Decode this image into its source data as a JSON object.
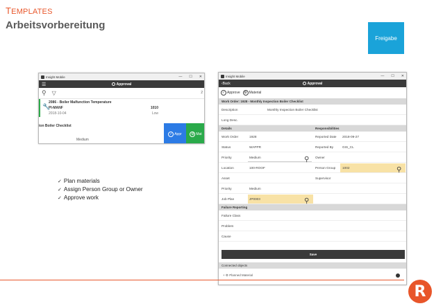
{
  "slide": {
    "kicker_initial": "T",
    "kicker_rest": "EMPLATES",
    "title": "Arbeitsvorbereitung",
    "freigabe_button": "Freigabe",
    "checklist": [
      "Plan materials",
      "Assign Person Group or Owner",
      "Approve work"
    ]
  },
  "win1": {
    "app_name": "Insight Mobile",
    "controls": [
      "—",
      "☐",
      "✕"
    ],
    "appbar_title": "Approval",
    "tools_number": "2",
    "item": {
      "title": "2086 - Boiler Malfunction Temperature",
      "location": "PI-MANF",
      "code": "1010",
      "date": "2018-10-04",
      "priority": "Low"
    },
    "checklist_text": "ion Boiler Checklist",
    "priority_text": "Medium",
    "approve_btn": "Appr",
    "material_btn": "Mat"
  },
  "win2": {
    "app_name": "Insight Mobile",
    "controls": [
      "—",
      "☐",
      "✕"
    ],
    "back_label": "Back",
    "appbar_title": "Approval",
    "approve_label": "Approve",
    "material_label": "Material",
    "work_order_header": "Work Order: 1928 - Monthly Inspection Boiler Checklist",
    "description_label": "Description",
    "description_value": "Monthly Inspection Boiler Checklist",
    "long_desc_label": "Long Desc.",
    "details_header": "Details",
    "responsibilities_header": "Responsibilities",
    "fields": {
      "work_order_label": "Work Order",
      "work_order_value": "1928",
      "status_label": "Status",
      "status_value": "WAPPR",
      "priority_label": "Priority",
      "priority_value": "Medium",
      "location_label": "Location",
      "location_value": "100-ROOF",
      "asset_label": "Asset",
      "priority2_label": "Priority",
      "priority2_value": "Medium",
      "job_plan_label": "Job Plan",
      "job_plan_value": "JP0003",
      "reported_date_label": "Reported Date",
      "reported_date_value": "2018-09-27",
      "reported_by_label": "Reported By",
      "reported_by_value": "GIS_CL",
      "owner_label": "Owner",
      "person_group_label": "Person Group",
      "person_group_value": "1002",
      "supervisor_label": "Supervisor"
    },
    "failure_header": "Failure Reporting",
    "failure_class_label": "Failure Class",
    "problem_label": "Problem",
    "cause_label": "Cause",
    "save_label": "Save",
    "connected_label": "Connected objects",
    "planned_material_label": "Planned Material",
    "plus": "+"
  },
  "logo_text": "R",
  "colors": {
    "accent": "#e8562a",
    "freigabe": "#1aa3d9",
    "approve": "#2c7be5",
    "material": "#2aaa4a",
    "highlight": "#f8e2a6"
  },
  "icons": [
    "search-icon",
    "filter-icon",
    "wrench-icon",
    "check-circle-icon",
    "gear-icon",
    "menu-icon",
    "back-chevron-icon"
  ]
}
